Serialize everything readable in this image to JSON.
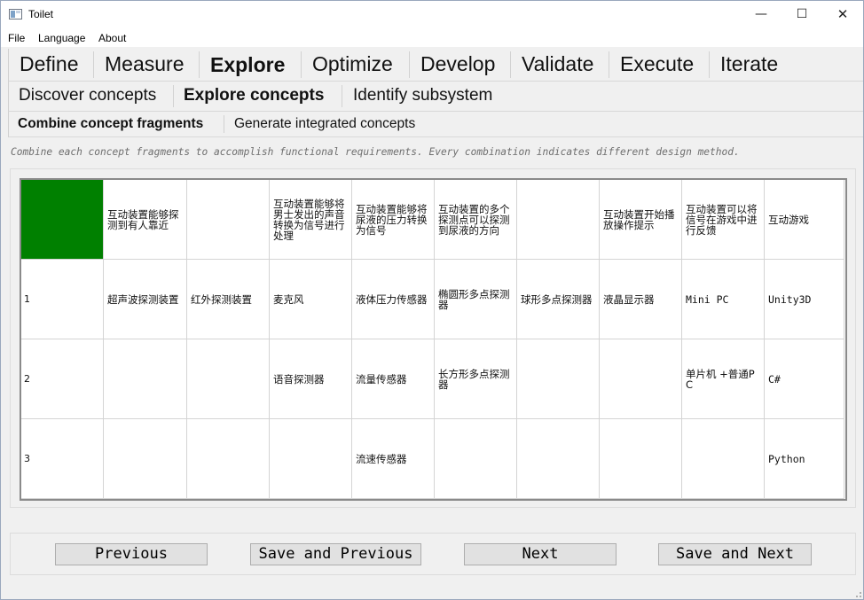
{
  "window": {
    "title": "Toilet",
    "controls": {
      "minimize": "—",
      "maximize": "☐",
      "close": "✕"
    }
  },
  "menu": {
    "items": [
      "File",
      "Language",
      "About"
    ]
  },
  "nav": {
    "phases": [
      "Define",
      "Measure",
      "Explore",
      "Optimize",
      "Develop",
      "Validate",
      "Execute",
      "Iterate"
    ],
    "active_phase": "Explore",
    "steps": [
      "Discover concepts",
      "Explore concepts",
      "Identify subsystem"
    ],
    "active_step": "Explore concepts",
    "substeps": [
      "Combine concept fragments",
      "Generate integrated concepts"
    ],
    "active_substep": "Combine concept fragments"
  },
  "instruction": "Combine each concept fragments to accomplish functional requirements. Every combination indicates different design method.",
  "table": {
    "corner_color": "#008000",
    "headers": [
      "",
      "互动装置能够探测到有人靠近",
      "",
      "互动装置能够将男士发出的声音转换为信号进行处理",
      "互动装置能够将尿液的压力转换为信号",
      "互动装置的多个探测点可以探测到尿液的方向",
      "",
      "互动装置开始播放操作提示",
      "互动装置可以将信号在游戏中进行反馈",
      "互动游戏"
    ],
    "rows": [
      [
        "1",
        "超声波探测装置",
        "红外探测装置",
        "麦克风",
        "液体压力传感器",
        "椭圆形多点探测器",
        "球形多点探测器",
        "液晶显示器",
        "Mini PC",
        "Unity3D"
      ],
      [
        "2",
        "",
        "",
        "语音探测器",
        "流量传感器",
        "长方形多点探测器",
        "",
        "",
        "单片机 +普通PC",
        "C#"
      ],
      [
        "3",
        "",
        "",
        "",
        "流速传感器",
        "",
        "",
        "",
        "",
        "Python"
      ]
    ]
  },
  "buttons": {
    "previous": "Previous",
    "save_previous": "Save and Previous",
    "next": "Next",
    "save_next": "Save and Next"
  }
}
